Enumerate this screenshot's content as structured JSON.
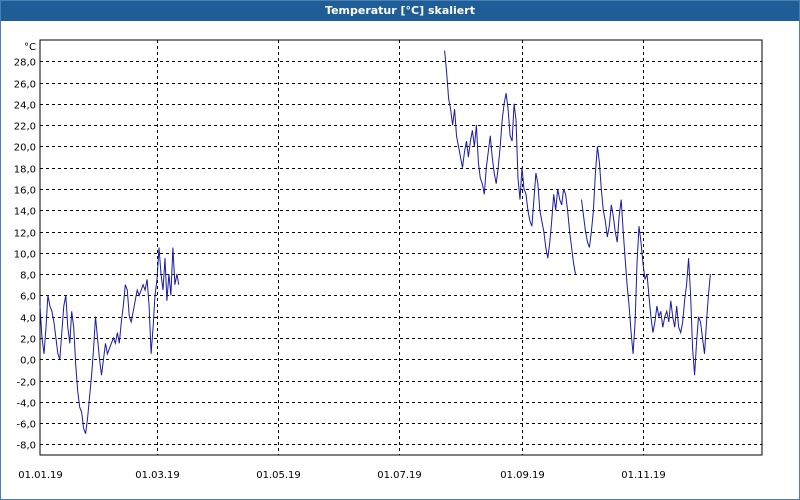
{
  "window": {
    "title": "Temperatur [°C] skaliert"
  },
  "chart_data": {
    "type": "line",
    "title": "Temperatur [°C] skaliert",
    "ylabel": "°C",
    "xlabel": "",
    "ylim": [
      -9.0,
      30.0
    ],
    "grid": true,
    "x_is_date": true,
    "xlim": [
      "2019-01-01",
      "2019-12-31"
    ],
    "y_ticks": [
      "28,0",
      "26,0",
      "24,0",
      "22,0",
      "20,0",
      "18,0",
      "16,0",
      "14,0",
      "12,0",
      "10,0",
      "8,0",
      "6,0",
      "4,0",
      "2,0",
      "0,0",
      "-2,0",
      "-4,0",
      "-6,0",
      "-8,0"
    ],
    "y_tick_values": [
      28,
      26,
      24,
      22,
      20,
      18,
      16,
      14,
      12,
      10,
      8,
      6,
      4,
      2,
      0,
      -2,
      -4,
      -6,
      -8
    ],
    "x_ticks": [
      "01.01.19",
      "01.03.19",
      "01.05.19",
      "01.07.19",
      "01.09.19",
      "01.11.19"
    ],
    "x_tick_dates": [
      "2019-01-01",
      "2019-03-01",
      "2019-05-01",
      "2019-07-01",
      "2019-09-01",
      "2019-11-01"
    ],
    "colors": {
      "line": "#1a1aa6",
      "grid": "#000000",
      "title_bar": "#1f5d97"
    },
    "series": [
      {
        "segments": [
          [
            [
              "2019-01-01",
              5.0
            ],
            [
              "2019-01-02",
              2.0
            ],
            [
              "2019-01-03",
              0.5
            ],
            [
              "2019-01-04",
              3.0
            ],
            [
              "2019-01-05",
              6.0
            ],
            [
              "2019-01-06",
              5.0
            ],
            [
              "2019-01-07",
              4.5
            ],
            [
              "2019-01-08",
              3.5
            ],
            [
              "2019-01-09",
              2.0
            ],
            [
              "2019-01-10",
              0.5
            ],
            [
              "2019-01-11",
              0.0
            ],
            [
              "2019-01-12",
              2.5
            ],
            [
              "2019-01-13",
              5.0
            ],
            [
              "2019-01-14",
              6.0
            ],
            [
              "2019-01-15",
              3.0
            ],
            [
              "2019-01-16",
              1.5
            ],
            [
              "2019-01-17",
              4.5
            ],
            [
              "2019-01-18",
              3.0
            ],
            [
              "2019-01-19",
              -0.5
            ],
            [
              "2019-01-20",
              -3.0
            ],
            [
              "2019-01-21",
              -4.5
            ],
            [
              "2019-01-22",
              -5.0
            ],
            [
              "2019-01-23",
              -6.5
            ],
            [
              "2019-01-24",
              -7.0
            ],
            [
              "2019-01-25",
              -5.5
            ],
            [
              "2019-01-26",
              -3.5
            ],
            [
              "2019-01-27",
              -1.5
            ],
            [
              "2019-01-28",
              1.0
            ],
            [
              "2019-01-29",
              4.0
            ],
            [
              "2019-01-30",
              2.0
            ],
            [
              "2019-01-31",
              0.0
            ],
            [
              "2019-02-01",
              -1.5
            ],
            [
              "2019-02-02",
              0.0
            ],
            [
              "2019-02-03",
              1.5
            ],
            [
              "2019-02-04",
              0.5
            ],
            [
              "2019-02-05",
              1.0
            ],
            [
              "2019-02-06",
              1.5
            ],
            [
              "2019-02-07",
              2.0
            ],
            [
              "2019-02-08",
              1.5
            ],
            [
              "2019-02-09",
              2.5
            ],
            [
              "2019-02-10",
              1.5
            ],
            [
              "2019-02-11",
              3.5
            ],
            [
              "2019-02-12",
              5.0
            ],
            [
              "2019-02-13",
              7.0
            ],
            [
              "2019-02-14",
              6.5
            ],
            [
              "2019-02-15",
              4.0
            ],
            [
              "2019-02-16",
              3.5
            ],
            [
              "2019-02-17",
              4.5
            ],
            [
              "2019-02-18",
              5.5
            ],
            [
              "2019-02-19",
              6.5
            ],
            [
              "2019-02-20",
              6.0
            ],
            [
              "2019-02-21",
              6.5
            ],
            [
              "2019-02-22",
              7.0
            ],
            [
              "2019-02-23",
              6.5
            ],
            [
              "2019-02-24",
              7.5
            ],
            [
              "2019-02-25",
              5.0
            ],
            [
              "2019-02-26",
              0.5
            ],
            [
              "2019-02-27",
              3.0
            ],
            [
              "2019-02-28",
              6.0
            ],
            [
              "2019-03-01",
              7.5
            ],
            [
              "2019-03-02",
              10.5
            ],
            [
              "2019-03-03",
              8.0
            ],
            [
              "2019-03-04",
              6.5
            ],
            [
              "2019-03-05",
              9.5
            ],
            [
              "2019-03-06",
              5.5
            ],
            [
              "2019-03-07",
              8.0
            ],
            [
              "2019-03-08",
              6.0
            ],
            [
              "2019-03-09",
              10.5
            ],
            [
              "2019-03-10",
              7.0
            ],
            [
              "2019-03-11",
              8.0
            ],
            [
              "2019-03-12",
              7.0
            ]
          ],
          [
            [
              "2019-07-24",
              29.0
            ],
            [
              "2019-07-25",
              27.0
            ],
            [
              "2019-07-26",
              24.5
            ],
            [
              "2019-07-27",
              23.5
            ],
            [
              "2019-07-28",
              22.0
            ],
            [
              "2019-07-29",
              23.5
            ],
            [
              "2019-07-30",
              21.0
            ],
            [
              "2019-07-31",
              20.0
            ],
            [
              "2019-08-01",
              19.0
            ],
            [
              "2019-08-02",
              18.0
            ],
            [
              "2019-08-03",
              19.5
            ],
            [
              "2019-08-04",
              20.5
            ],
            [
              "2019-08-05",
              19.0
            ],
            [
              "2019-08-06",
              20.5
            ],
            [
              "2019-08-07",
              21.5
            ],
            [
              "2019-08-08",
              20.0
            ],
            [
              "2019-08-09",
              22.0
            ],
            [
              "2019-08-10",
              18.5
            ],
            [
              "2019-08-11",
              17.0
            ],
            [
              "2019-08-12",
              16.5
            ],
            [
              "2019-08-13",
              15.5
            ],
            [
              "2019-08-14",
              18.0
            ],
            [
              "2019-08-15",
              19.5
            ],
            [
              "2019-08-16",
              21.0
            ],
            [
              "2019-08-17",
              19.0
            ],
            [
              "2019-08-18",
              17.5
            ],
            [
              "2019-08-19",
              16.5
            ],
            [
              "2019-08-20",
              18.0
            ],
            [
              "2019-08-21",
              20.0
            ],
            [
              "2019-08-22",
              22.5
            ],
            [
              "2019-08-23",
              24.0
            ],
            [
              "2019-08-24",
              25.0
            ],
            [
              "2019-08-25",
              23.5
            ],
            [
              "2019-08-26",
              21.0
            ],
            [
              "2019-08-27",
              20.5
            ],
            [
              "2019-08-28",
              24.0
            ],
            [
              "2019-08-29",
              22.5
            ],
            [
              "2019-08-30",
              17.0
            ],
            [
              "2019-08-31",
              15.0
            ],
            [
              "2019-09-01",
              18.0
            ],
            [
              "2019-09-02",
              16.0
            ],
            [
              "2019-09-03",
              15.5
            ],
            [
              "2019-09-04",
              14.0
            ],
            [
              "2019-09-05",
              13.0
            ],
            [
              "2019-09-06",
              12.5
            ],
            [
              "2019-09-07",
              15.0
            ],
            [
              "2019-09-08",
              17.5
            ],
            [
              "2019-09-09",
              16.5
            ],
            [
              "2019-09-10",
              14.0
            ],
            [
              "2019-09-11",
              13.0
            ],
            [
              "2019-09-12",
              12.0
            ],
            [
              "2019-09-13",
              10.5
            ],
            [
              "2019-09-14",
              9.5
            ],
            [
              "2019-09-15",
              11.0
            ],
            [
              "2019-09-16",
              13.0
            ],
            [
              "2019-09-17",
              15.5
            ],
            [
              "2019-09-18",
              14.0
            ],
            [
              "2019-09-19",
              16.0
            ],
            [
              "2019-09-20",
              15.0
            ],
            [
              "2019-09-21",
              14.5
            ],
            [
              "2019-09-22",
              16.0
            ],
            [
              "2019-09-23",
              15.5
            ],
            [
              "2019-09-24",
              14.0
            ],
            [
              "2019-09-25",
              12.0
            ],
            [
              "2019-09-26",
              10.5
            ],
            [
              "2019-09-27",
              9.0
            ],
            [
              "2019-09-28",
              8.0
            ]
          ],
          [
            [
              "2019-10-01",
              15.0
            ],
            [
              "2019-10-02",
              13.5
            ],
            [
              "2019-10-03",
              12.0
            ],
            [
              "2019-10-04",
              11.0
            ],
            [
              "2019-10-05",
              10.5
            ],
            [
              "2019-10-06",
              12.0
            ],
            [
              "2019-10-07",
              14.0
            ],
            [
              "2019-10-08",
              17.5
            ],
            [
              "2019-10-09",
              20.0
            ],
            [
              "2019-10-10",
              18.5
            ],
            [
              "2019-10-11",
              16.0
            ],
            [
              "2019-10-12",
              14.0
            ],
            [
              "2019-10-13",
              13.0
            ],
            [
              "2019-10-14",
              11.5
            ],
            [
              "2019-10-15",
              12.5
            ],
            [
              "2019-10-16",
              14.5
            ],
            [
              "2019-10-17",
              13.5
            ],
            [
              "2019-10-18",
              12.0
            ],
            [
              "2019-10-19",
              11.0
            ],
            [
              "2019-10-20",
              13.5
            ],
            [
              "2019-10-21",
              15.0
            ],
            [
              "2019-10-22",
              12.0
            ],
            [
              "2019-10-23",
              9.5
            ],
            [
              "2019-10-24",
              7.0
            ],
            [
              "2019-10-25",
              5.0
            ],
            [
              "2019-10-26",
              2.5
            ],
            [
              "2019-10-27",
              0.5
            ],
            [
              "2019-10-28",
              3.5
            ],
            [
              "2019-10-29",
              9.0
            ],
            [
              "2019-10-30",
              12.5
            ],
            [
              "2019-10-31",
              11.0
            ],
            [
              "2019-11-01",
              9.0
            ],
            [
              "2019-11-02",
              7.5
            ],
            [
              "2019-11-03",
              8.0
            ],
            [
              "2019-11-04",
              6.0
            ],
            [
              "2019-11-05",
              4.0
            ],
            [
              "2019-11-06",
              2.5
            ],
            [
              "2019-11-07",
              3.5
            ],
            [
              "2019-11-08",
              5.0
            ],
            [
              "2019-11-09",
              4.0
            ],
            [
              "2019-11-10",
              4.5
            ],
            [
              "2019-11-11",
              3.0
            ],
            [
              "2019-11-12",
              4.0
            ],
            [
              "2019-11-13",
              4.5
            ],
            [
              "2019-11-14",
              3.5
            ],
            [
              "2019-11-15",
              5.5
            ],
            [
              "2019-11-16",
              4.0
            ],
            [
              "2019-11-17",
              3.0
            ],
            [
              "2019-11-18",
              5.0
            ],
            [
              "2019-11-19",
              3.0
            ],
            [
              "2019-11-20",
              2.5
            ],
            [
              "2019-11-21",
              3.5
            ],
            [
              "2019-11-22",
              5.5
            ],
            [
              "2019-11-23",
              7.0
            ],
            [
              "2019-11-24",
              9.5
            ],
            [
              "2019-11-25",
              6.0
            ],
            [
              "2019-11-26",
              1.0
            ],
            [
              "2019-11-27",
              -1.5
            ],
            [
              "2019-11-28",
              1.5
            ],
            [
              "2019-11-29",
              4.0
            ],
            [
              "2019-11-30",
              3.5
            ],
            [
              "2019-12-01",
              2.0
            ],
            [
              "2019-12-02",
              0.5
            ],
            [
              "2019-12-03",
              3.5
            ],
            [
              "2019-12-04",
              6.0
            ],
            [
              "2019-12-05",
              8.0
            ]
          ]
        ]
      }
    ]
  }
}
